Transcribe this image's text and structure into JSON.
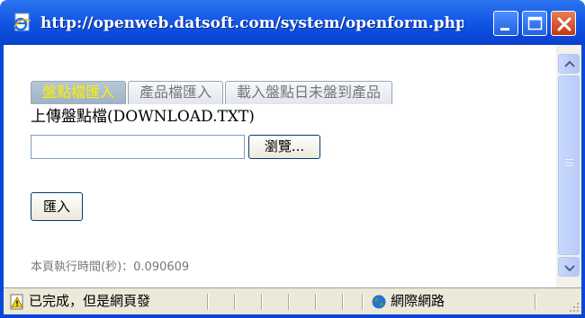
{
  "window": {
    "title": "http://openweb.datsoft.com/system/openform.php?_..."
  },
  "tabs": [
    {
      "label": "盤點檔匯入",
      "active": true
    },
    {
      "label": "產品檔匯入",
      "active": false
    },
    {
      "label": "載入盤點日未盤到產品",
      "active": false
    }
  ],
  "form": {
    "upload_label": "上傳盤點檔(DOWNLOAD.TXT)",
    "file_value": "",
    "browse_label": "瀏覽...",
    "import_label": "匯入"
  },
  "footer": {
    "exec_time": "本頁執行時間(秒)：0.090609"
  },
  "statusbar": {
    "status_text": "已完成，但是網頁發",
    "zone_text": "網際網路"
  },
  "colors": {
    "titlebar": "#0a48d8",
    "active_tab_text": "#ffee00",
    "active_tab_bg": "#a9bccd"
  },
  "icons": {
    "title": "ie-page-icon",
    "status": "warning-page-icon",
    "zone": "globe-icon"
  }
}
